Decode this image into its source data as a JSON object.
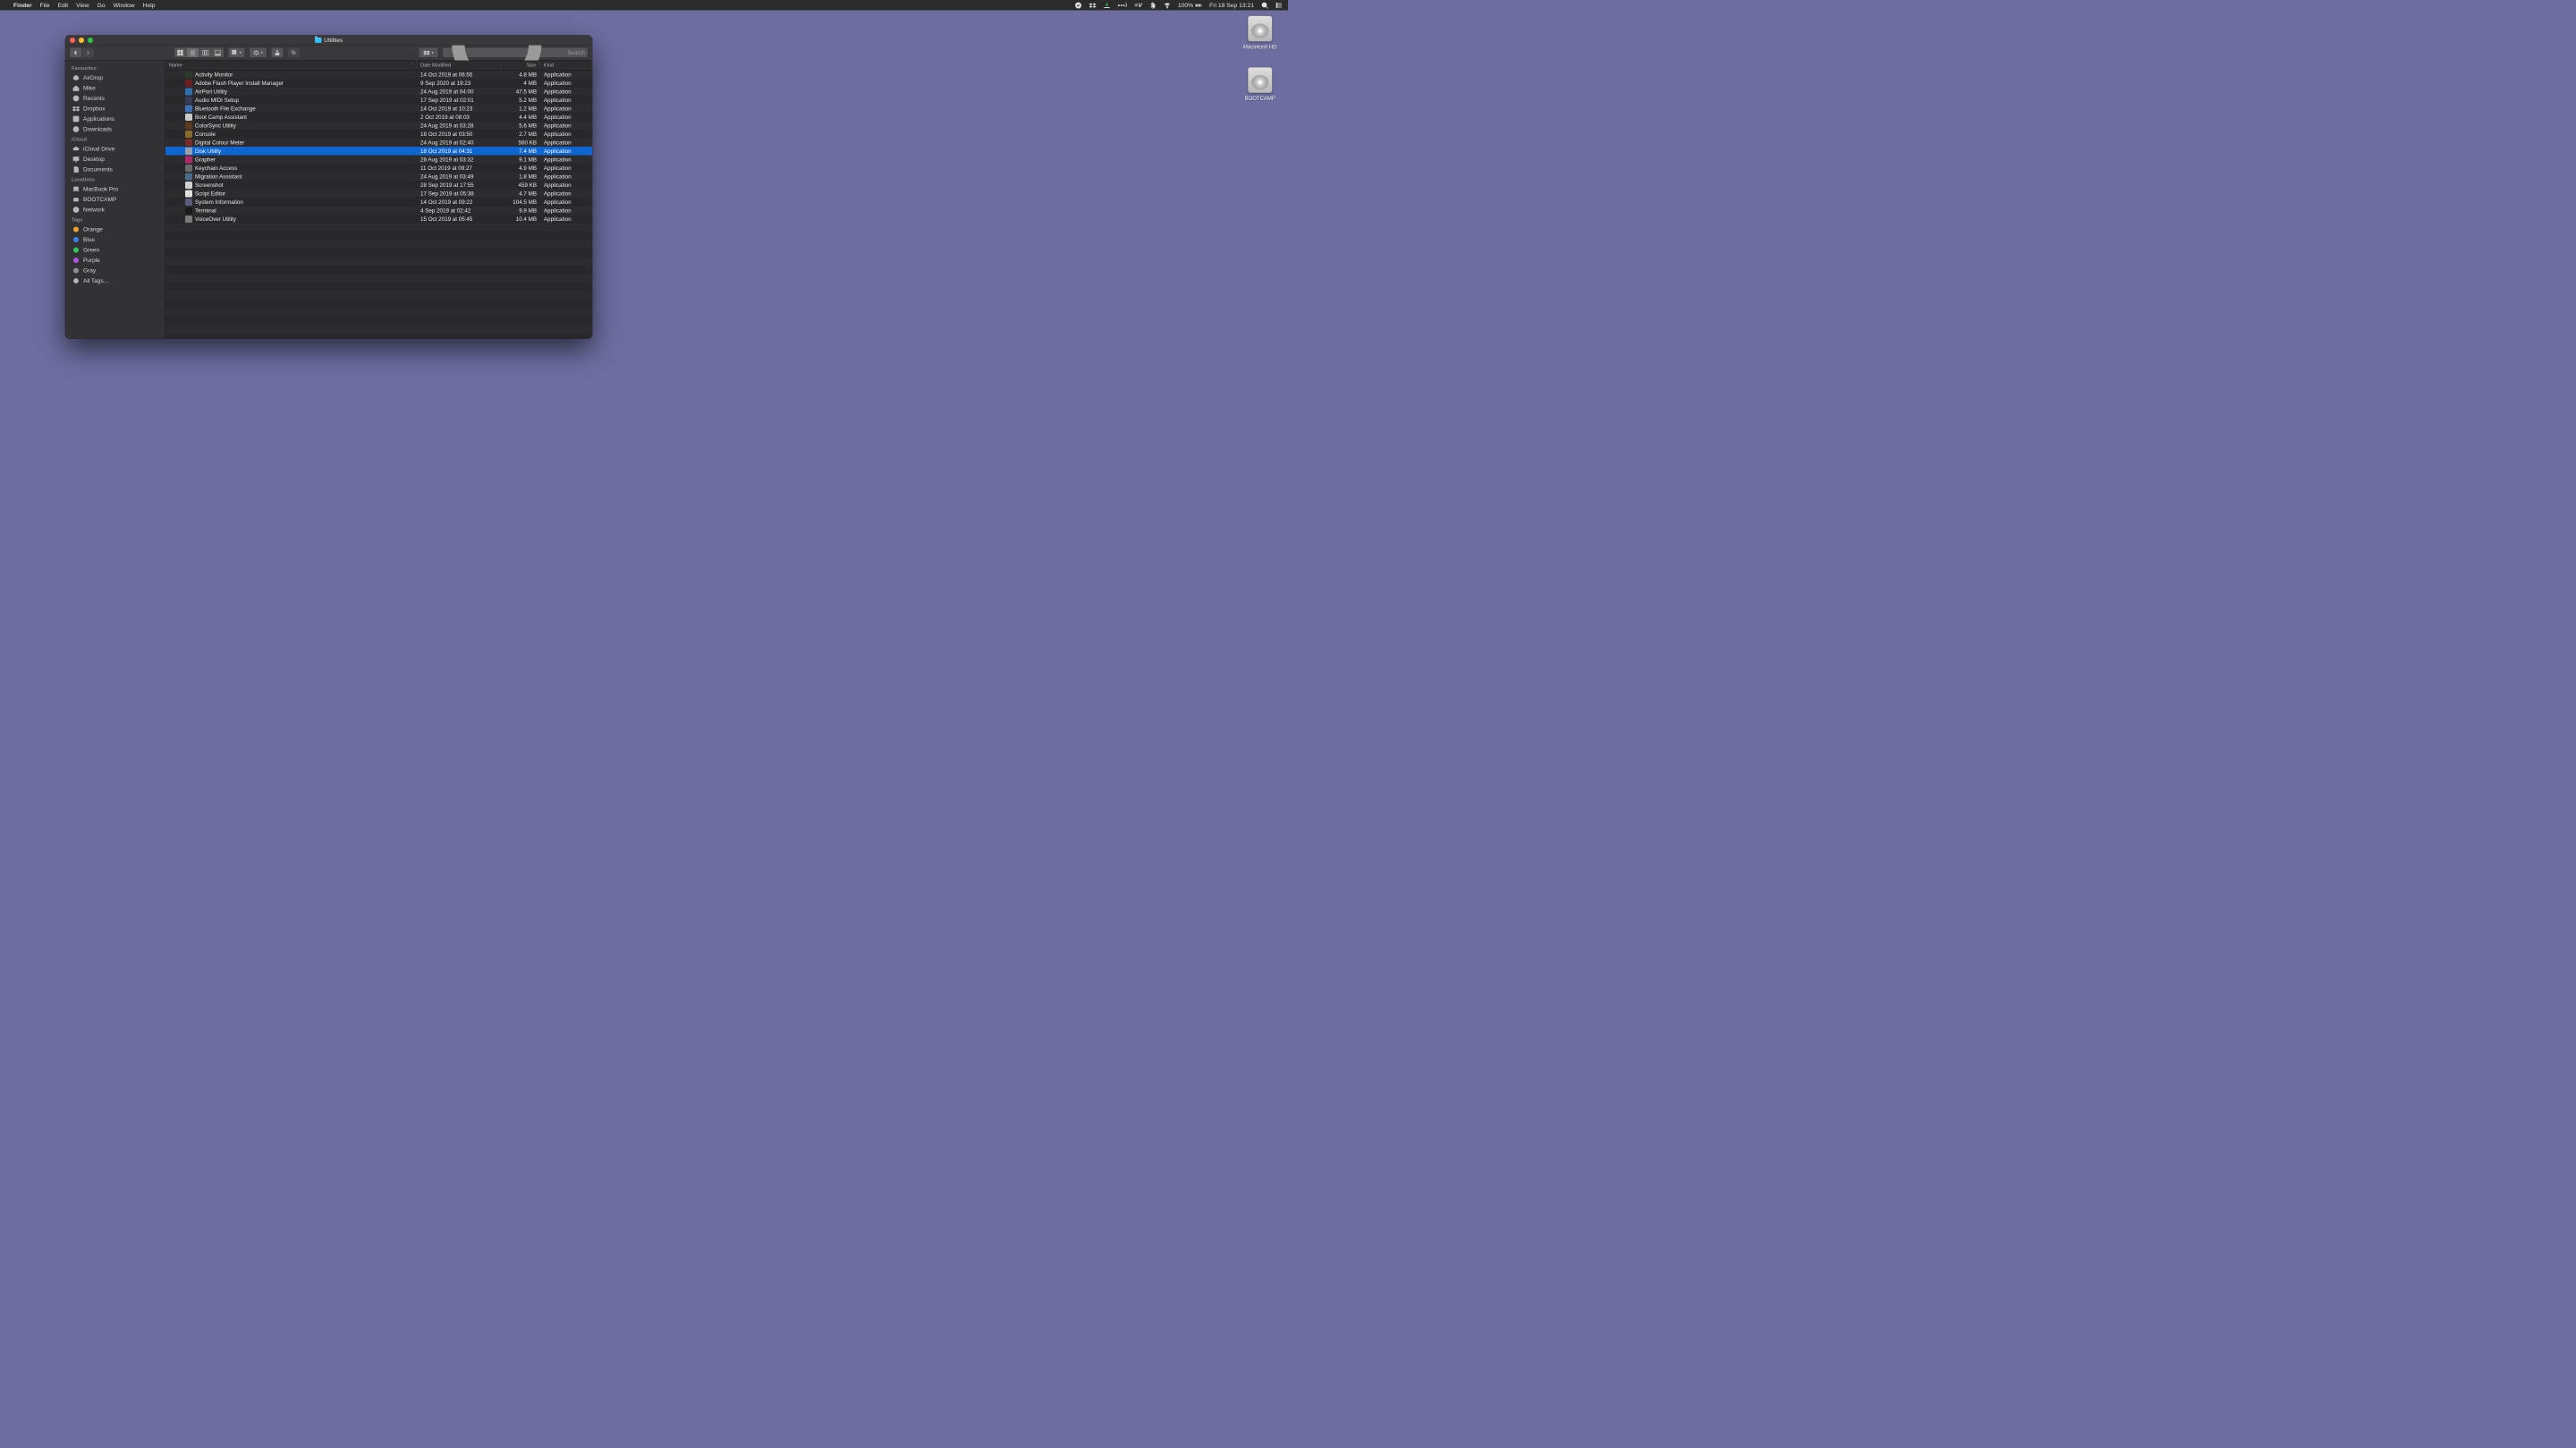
{
  "menubar": {
    "app": "Finder",
    "items": [
      "File",
      "Edit",
      "View",
      "Go",
      "Window",
      "Help"
    ],
    "battery": "100%",
    "datetime": "Fri 18 Sep  13:21"
  },
  "desktop": {
    "drives": [
      {
        "label": "Macintosh HD"
      },
      {
        "label": "BOOTCAMP"
      }
    ]
  },
  "finder": {
    "window_title": "Utilities",
    "search_placeholder": "Search",
    "columns": {
      "name": "Name",
      "date": "Date Modified",
      "size": "Size",
      "kind": "Kind"
    },
    "sidebar": {
      "favourites_title": "Favourites",
      "favourites": [
        "AirDrop",
        "Mike",
        "Recents",
        "Dropbox",
        "Applications",
        "Downloads"
      ],
      "icloud_title": "iCloud",
      "icloud": [
        "iCloud Drive",
        "Desktop",
        "Documents"
      ],
      "locations_title": "Locations",
      "locations": [
        "MacBook Pro",
        "BOOTCAMP",
        "Network"
      ],
      "tags_title": "Tags",
      "tags": [
        {
          "label": "Orange",
          "color": "#f0a132"
        },
        {
          "label": "Blue",
          "color": "#3b82f6"
        },
        {
          "label": "Green",
          "color": "#34c759"
        },
        {
          "label": "Purple",
          "color": "#af52de"
        },
        {
          "label": "Gray",
          "color": "#8e8e93"
        }
      ],
      "all_tags": "All Tags…"
    },
    "selected_row": 8,
    "rows": [
      {
        "name": "Activity Monitor",
        "date": "14 Oct 2019 at 06:55",
        "size": "4.8 MB",
        "kind": "Application",
        "color": "#2a3b2a"
      },
      {
        "name": "Adobe Flash Player Install Manager",
        "date": "9 Sep 2020 at 19:23",
        "size": "4 MB",
        "kind": "Application",
        "color": "#6b1f1f"
      },
      {
        "name": "AirPort Utility",
        "date": "24 Aug 2019 at 04:00",
        "size": "47.5 MB",
        "kind": "Application",
        "color": "#2f6fb0"
      },
      {
        "name": "Audio MIDI Setup",
        "date": "17 Sep 2019 at 02:01",
        "size": "5.2 MB",
        "kind": "Application",
        "color": "#3a3a5a"
      },
      {
        "name": "Bluetooth File Exchange",
        "date": "14 Oct 2019 at 10:23",
        "size": "1.2 MB",
        "kind": "Application",
        "color": "#3b6fb8"
      },
      {
        "name": "Boot Camp Assistant",
        "date": "2 Oct 2019 at 08:03",
        "size": "4.4 MB",
        "kind": "Application",
        "color": "#c9c9c9"
      },
      {
        "name": "ColorSync Utility",
        "date": "24 Aug 2019 at 03:28",
        "size": "5.6 MB",
        "kind": "Application",
        "color": "#5c3b1f"
      },
      {
        "name": "Console",
        "date": "18 Oct 2019 at 03:50",
        "size": "2.7 MB",
        "kind": "Application",
        "color": "#8a6b2a"
      },
      {
        "name": "Digital Colour Meter",
        "date": "24 Aug 2019 at 02:40",
        "size": "560 KB",
        "kind": "Application",
        "color": "#7b2a2a"
      },
      {
        "name": "Disk Utility",
        "date": "18 Oct 2019 at 04:31",
        "size": "7.4 MB",
        "kind": "Application",
        "color": "#9aa0a6"
      },
      {
        "name": "Grapher",
        "date": "28 Aug 2019 at 03:32",
        "size": "9.1 MB",
        "kind": "Application",
        "color": "#b02a6a"
      },
      {
        "name": "Keychain Access",
        "date": "11 Oct 2019 at 09:27",
        "size": "4.9 MB",
        "kind": "Application",
        "color": "#6a6a6a"
      },
      {
        "name": "Migration Assistant",
        "date": "24 Aug 2019 at 03:49",
        "size": "1.8 MB",
        "kind": "Application",
        "color": "#4a6a8a"
      },
      {
        "name": "Screenshot",
        "date": "28 Sep 2019 at 17:55",
        "size": "459 KB",
        "kind": "Application",
        "color": "#d0d0d0"
      },
      {
        "name": "Script Editor",
        "date": "17 Sep 2019 at 05:38",
        "size": "4.7 MB",
        "kind": "Application",
        "color": "#e0e0e0"
      },
      {
        "name": "System Information",
        "date": "14 Oct 2019 at 09:22",
        "size": "104.5 MB",
        "kind": "Application",
        "color": "#5a5a7a"
      },
      {
        "name": "Terminal",
        "date": "4 Sep 2019 at 02:42",
        "size": "9.9 MB",
        "kind": "Application",
        "color": "#1a1a1a"
      },
      {
        "name": "VoiceOver Utility",
        "date": "15 Oct 2019 at 05:45",
        "size": "10.4 MB",
        "kind": "Application",
        "color": "#7a7a7a"
      }
    ]
  }
}
